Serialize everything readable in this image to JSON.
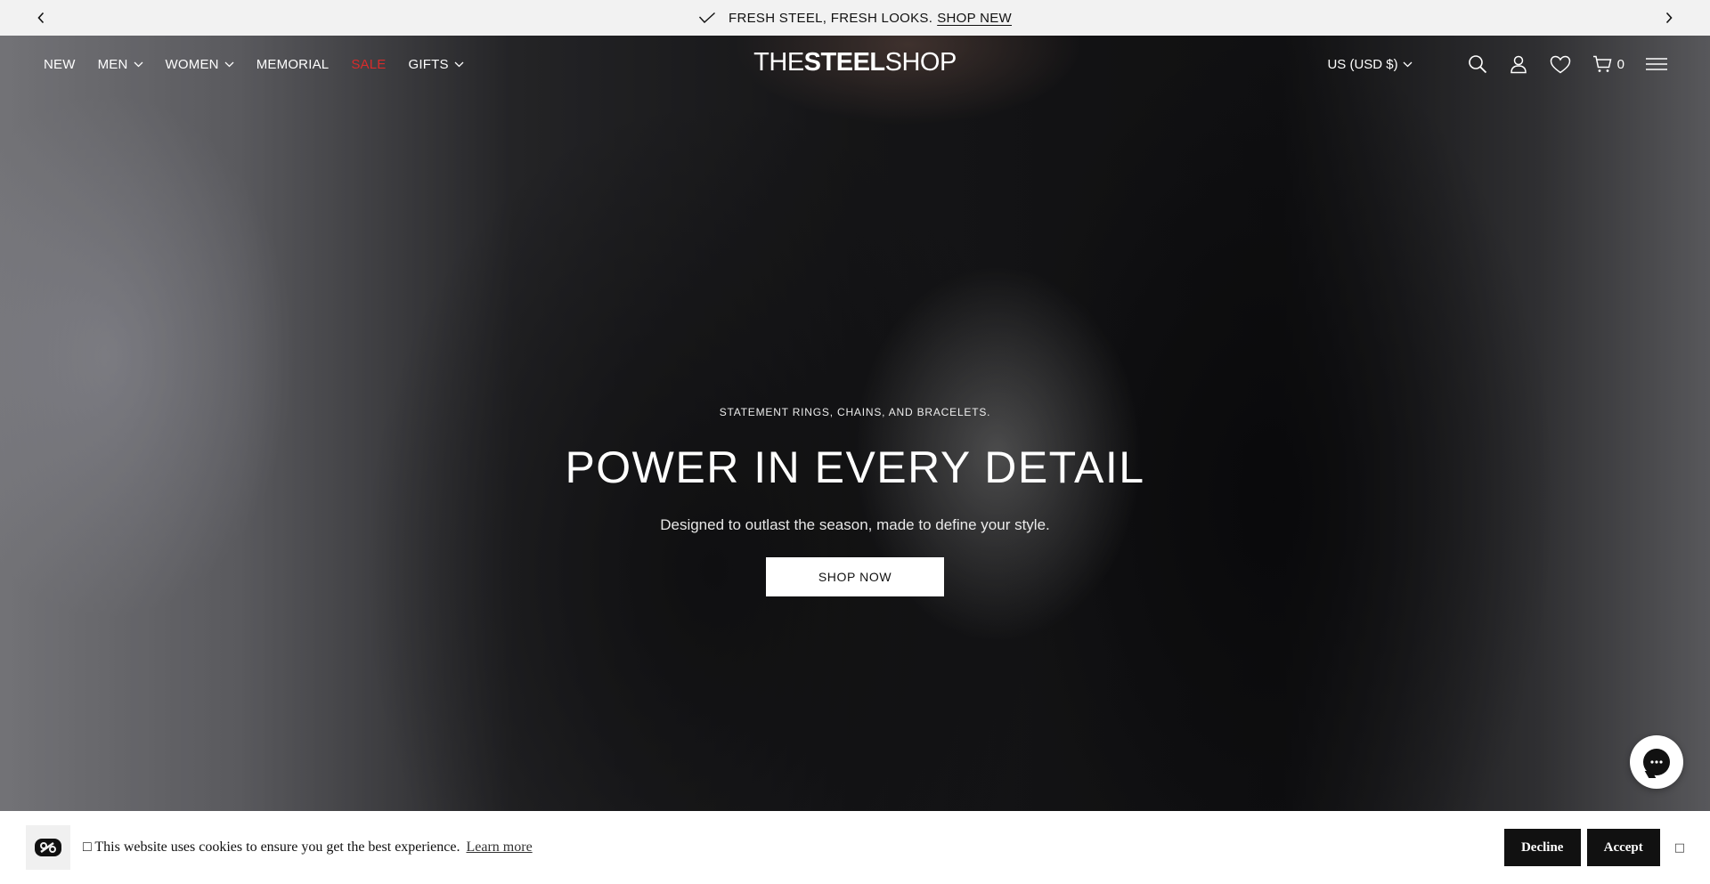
{
  "announcement": {
    "text": "FRESH STEEL, FRESH LOOKS.",
    "link": "SHOP NEW"
  },
  "nav": {
    "items": [
      {
        "label": "NEW",
        "dropdown": false
      },
      {
        "label": "MEN",
        "dropdown": true
      },
      {
        "label": "WOMEN",
        "dropdown": true
      },
      {
        "label": "MEMORIAL",
        "dropdown": false
      },
      {
        "label": "SALE",
        "dropdown": false,
        "color": "#d92b2b"
      },
      {
        "label": "GIFTS",
        "dropdown": true
      }
    ]
  },
  "logo": {
    "part1": "THE",
    "part2": "STEEL",
    "part3": "SHOP"
  },
  "header": {
    "currency": "US (USD $)",
    "cart_count": "0",
    "icons": [
      "search-icon",
      "account-icon",
      "wishlist-icon",
      "cart-icon",
      "menu-icon"
    ]
  },
  "hero": {
    "eyebrow": "STATEMENT RINGS, CHAINS, AND BRACELETS.",
    "headline": "POWER IN EVERY DETAIL",
    "subline": "Designed to outlast the season, made to define your style.",
    "cta": "SHOP NOW"
  },
  "cookie": {
    "message": "This website uses cookies to ensure you get the best experience.",
    "learn_more": "Learn more",
    "decline": "Decline",
    "accept": "Accept"
  },
  "colors": {
    "announcement_bg": "#f2f2f2",
    "sale": "#d92b2b",
    "button_dark": "#111111"
  }
}
